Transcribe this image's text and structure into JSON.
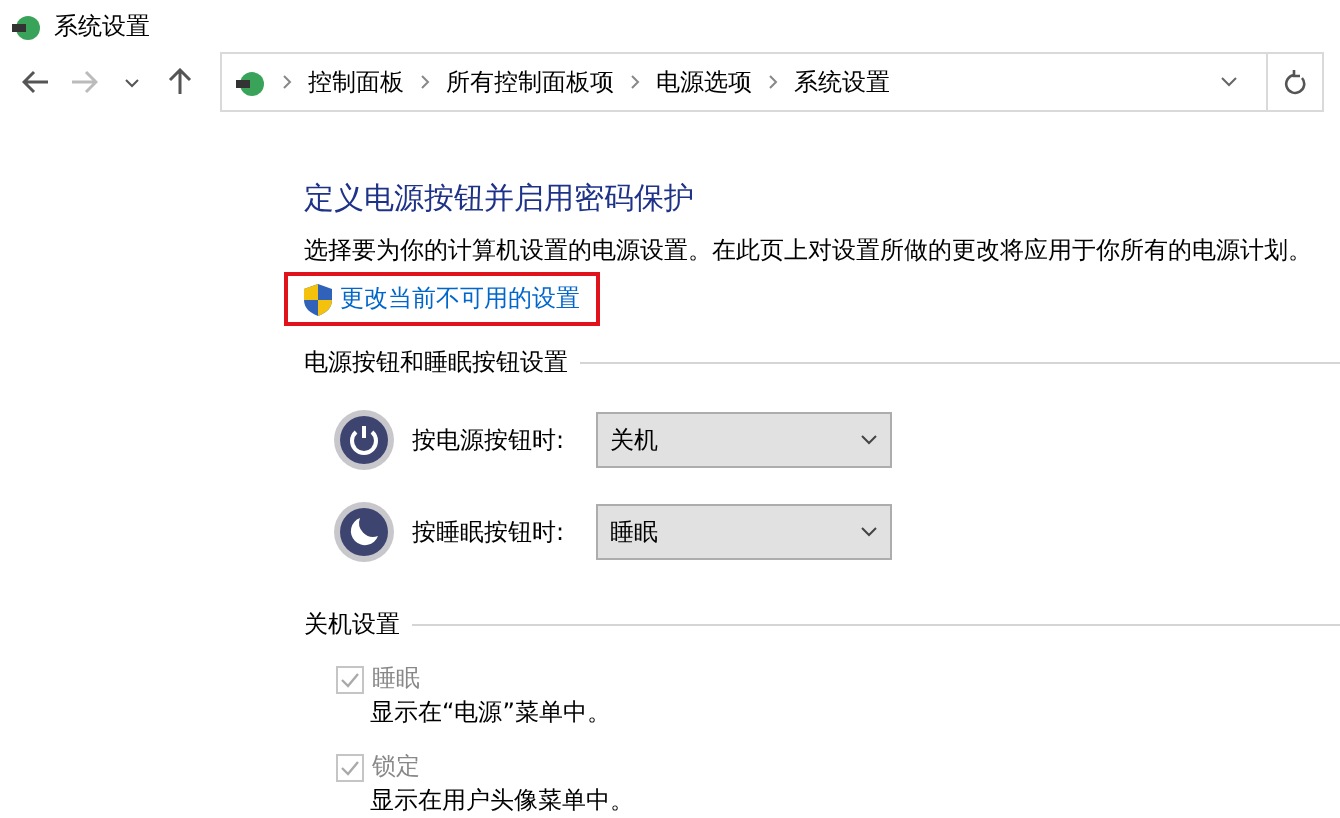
{
  "window": {
    "title": "系统设置"
  },
  "breadcrumb": [
    "控制面板",
    "所有控制面板项",
    "电源选项",
    "系统设置"
  ],
  "heading": "定义电源按钮并启用密码保护",
  "description": "选择要为你的计算机设置的电源设置。在此页上对设置所做的更改将应用于你所有的电源计划。",
  "admin_link": {
    "label": "更改当前不可用的设置",
    "highlighted": true
  },
  "button_section": {
    "title": "电源按钮和睡眠按钮设置",
    "rows": [
      {
        "kind": "power",
        "label": "按电源按钮时:",
        "value": "关机"
      },
      {
        "kind": "sleep",
        "label": "按睡眠按钮时:",
        "value": "睡眠"
      }
    ]
  },
  "shutdown_section": {
    "title": "关机设置",
    "options": [
      {
        "label": "睡眠",
        "checked": true,
        "disabled": true,
        "hint": "显示在“电源”菜单中。"
      },
      {
        "label": "锁定",
        "checked": true,
        "disabled": true,
        "hint": "显示在用户头像菜单中。"
      }
    ]
  }
}
